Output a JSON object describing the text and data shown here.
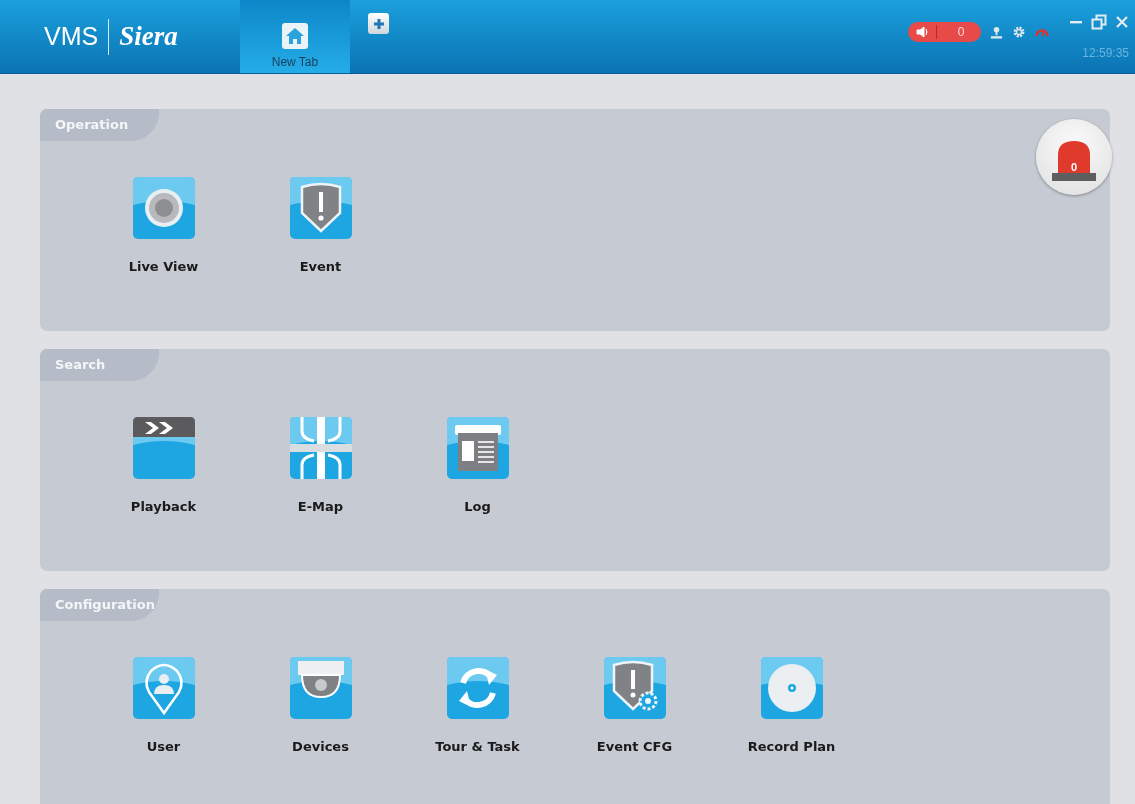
{
  "header": {
    "logo": {
      "vms": "VMS",
      "brand": "Siera"
    },
    "tabs": [
      {
        "label": "New Tab",
        "selected": true
      }
    ],
    "alarm_count": "0",
    "time": "12:59:35"
  },
  "alarm_beacon": {
    "count": "0"
  },
  "sections": [
    {
      "title": "Operation",
      "items": [
        {
          "label": "Live View",
          "kind": "camera"
        },
        {
          "label": "Event",
          "kind": "shield"
        }
      ]
    },
    {
      "title": "Search",
      "items": [
        {
          "label": "Playback",
          "kind": "clapper"
        },
        {
          "label": "E-Map",
          "kind": "map"
        },
        {
          "label": "Log",
          "kind": "log"
        }
      ]
    },
    {
      "title": "Configuration",
      "items": [
        {
          "label": "User",
          "kind": "user"
        },
        {
          "label": "Devices",
          "kind": "dome"
        },
        {
          "label": "Tour & Task",
          "kind": "refresh"
        },
        {
          "label": "Event CFG",
          "kind": "shieldgear"
        },
        {
          "label": "Record Plan",
          "kind": "disc"
        }
      ]
    }
  ]
}
